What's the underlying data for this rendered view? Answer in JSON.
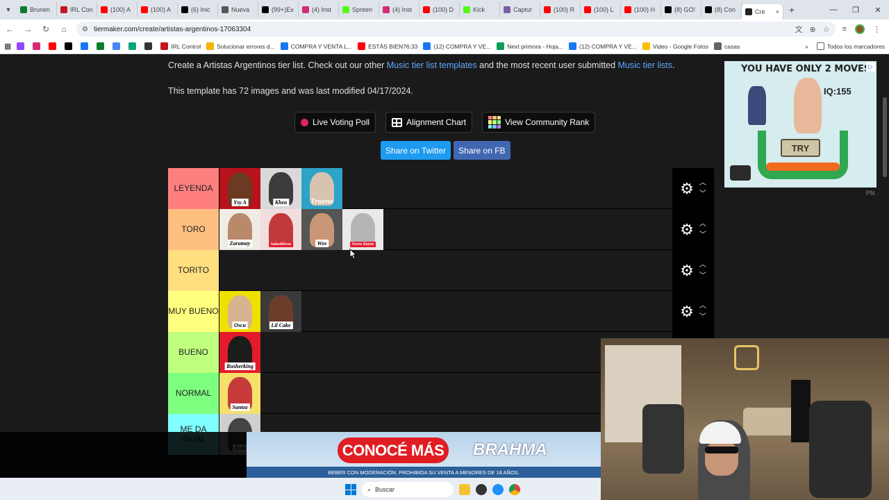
{
  "browser": {
    "tabs": [
      {
        "label": "Brunen",
        "color": "#0a7d2b"
      },
      {
        "label": "IRL Con",
        "color": "#c4161c"
      },
      {
        "label": "(100) A",
        "color": "#ff0000"
      },
      {
        "label": "(100) A",
        "color": "#ff0000"
      },
      {
        "label": "(6) Inic",
        "color": "#000000"
      },
      {
        "label": "Nueva",
        "color": "#555555"
      },
      {
        "label": "(99+)Ex",
        "color": "#000000"
      },
      {
        "label": "(4) Inst",
        "color": "#d62976"
      },
      {
        "label": "Spreen",
        "color": "#53fc18"
      },
      {
        "label": "(4) Inst",
        "color": "#d62976"
      },
      {
        "label": "(100) D",
        "color": "#ff0000"
      },
      {
        "label": "Kick",
        "color": "#53fc18"
      },
      {
        "label": "Captur",
        "color": "#7b5ea7"
      },
      {
        "label": "(100) R",
        "color": "#ff0000"
      },
      {
        "label": "(100) L",
        "color": "#ff0000"
      },
      {
        "label": "(100) H",
        "color": "#ff0000"
      },
      {
        "label": "(8) GO!",
        "color": "#000000"
      },
      {
        "label": "(8) Con",
        "color": "#000000"
      }
    ],
    "active_tab": {
      "label": "Cre",
      "close": "×"
    },
    "new_tab": "+",
    "url": "tiermaker.com/create/artistas-argentinos-17063304",
    "bookmarks": [
      {
        "label": "",
        "color": "#9146ff"
      },
      {
        "label": "",
        "color": "#d62976"
      },
      {
        "label": "",
        "color": "#ff0000"
      },
      {
        "label": "",
        "color": "#000000"
      },
      {
        "label": "",
        "color": "#1877f2"
      },
      {
        "label": "",
        "color": "#0a7d2b"
      },
      {
        "label": "",
        "color": "#4285f4"
      },
      {
        "label": "",
        "color": "#10a37f"
      },
      {
        "label": "",
        "color": "#333333"
      },
      {
        "label": "IRL Control",
        "color": "#c4161c"
      },
      {
        "label": "Solucionar errores d...",
        "color": "#f4b400"
      },
      {
        "label": "COMPRA Y VENTA L...",
        "color": "#1877f2"
      },
      {
        "label": "ESTÁS BIEN?6:33",
        "color": "#ff0000"
      },
      {
        "label": "(12) COMPRA Y VE...",
        "color": "#1877f2"
      },
      {
        "label": "Next primora - Hoja...",
        "color": "#0f9d58"
      },
      {
        "label": "(12) COMPRA Y VE...",
        "color": "#1877f2"
      },
      {
        "label": "Video - Google Fotos",
        "color": "#fbbc04"
      },
      {
        "label": "casas",
        "color": "#5f6368"
      }
    ],
    "bookmarks_overflow": "»",
    "all_bookmarks": "Todos los marcadores"
  },
  "page": {
    "intro_prefix": "Create a Artistas Argentinos tier list. Check out our other ",
    "intro_link1": "Music tier list templates",
    "intro_mid": " and the most recent user submitted ",
    "intro_link2": "Music tier lists",
    "intro_suffix": ".",
    "template_info": "This template has 72 images and was last modified 04/17/2024.",
    "buttons": {
      "live_voting": "Live Voting Poll",
      "alignment": "Alignment Chart",
      "community_rank": "View Community Rank"
    },
    "share": {
      "twitter": "Share on Twitter",
      "facebook": "Share on FB"
    }
  },
  "tiers": [
    {
      "label": "LEYENDA",
      "color": "#ff7f7f",
      "items": [
        {
          "name": "Ysy A",
          "bg": "#b8121a",
          "skin": "#6a3b22",
          "style": "white"
        },
        {
          "name": "Khea",
          "bg": "#d9d9d9",
          "skin": "#3c3c3c",
          "style": "white"
        },
        {
          "name": "Trueno",
          "bg": "#2ea3c8",
          "skin": "#d8c3b0",
          "style": "plain"
        }
      ]
    },
    {
      "label": "TORO",
      "color": "#ffbf7f",
      "items": [
        {
          "name": "Zaramay",
          "bg": "#f0ebe4",
          "skin": "#b98a6a",
          "style": "white"
        },
        {
          "name": "Salastkbron",
          "bg": "#f2dede",
          "skin": "#c03a3a",
          "style": "red"
        },
        {
          "name": "Wos",
          "bg": "#555555",
          "skin": "#c99777",
          "style": "white"
        },
        {
          "name": "Seven Kayne",
          "bg": "#e9e9e9",
          "skin": "#b5b5b5",
          "style": "red"
        }
      ]
    },
    {
      "label": "TORITO",
      "color": "#ffdf7f",
      "items": []
    },
    {
      "label": "MUY BUENO",
      "color": "#ffff7f",
      "items": [
        {
          "name": "Oscu",
          "bg": "#f0e000",
          "skin": "#d6b48f",
          "style": "white"
        },
        {
          "name": "Lil Cake",
          "bg": "#3a3a3a",
          "skin": "#6b3d2a",
          "style": "white"
        }
      ]
    },
    {
      "label": "BUENO",
      "color": "#bfff7f",
      "items": [
        {
          "name": "Rusherking",
          "bg": "#e21b2d",
          "skin": "#1c1c1c",
          "style": "white"
        }
      ]
    },
    {
      "label": "NORMAL",
      "color": "#7fff7f",
      "items": [
        {
          "name": "Santoz",
          "bg": "#f4e06a",
          "skin": "#c73a3a",
          "style": "white"
        }
      ]
    },
    {
      "label": "ME DA IGUAL",
      "color": "#7fffff",
      "items": [
        {
          "name": "Kodi",
          "bg": "#cfcfcf",
          "skin": "#444444",
          "style": "white"
        }
      ]
    }
  ],
  "ads": {
    "right_banner_text": "YOU HAVE ONLY 2 MOVES",
    "right_banner_iq": "IQ:155",
    "right_banner_button": "TRY",
    "right_banner_mark": "PN",
    "bottom_cta": "CONOCÉ MÁS",
    "bottom_brand": "BRAHMA",
    "bottom_legal": "BEBER CON MODERACIÓN. PROHIBIDA SU VENTA A MENORES DE 18 AÑOS."
  },
  "taskbar": {
    "search_placeholder": "Buscar"
  }
}
